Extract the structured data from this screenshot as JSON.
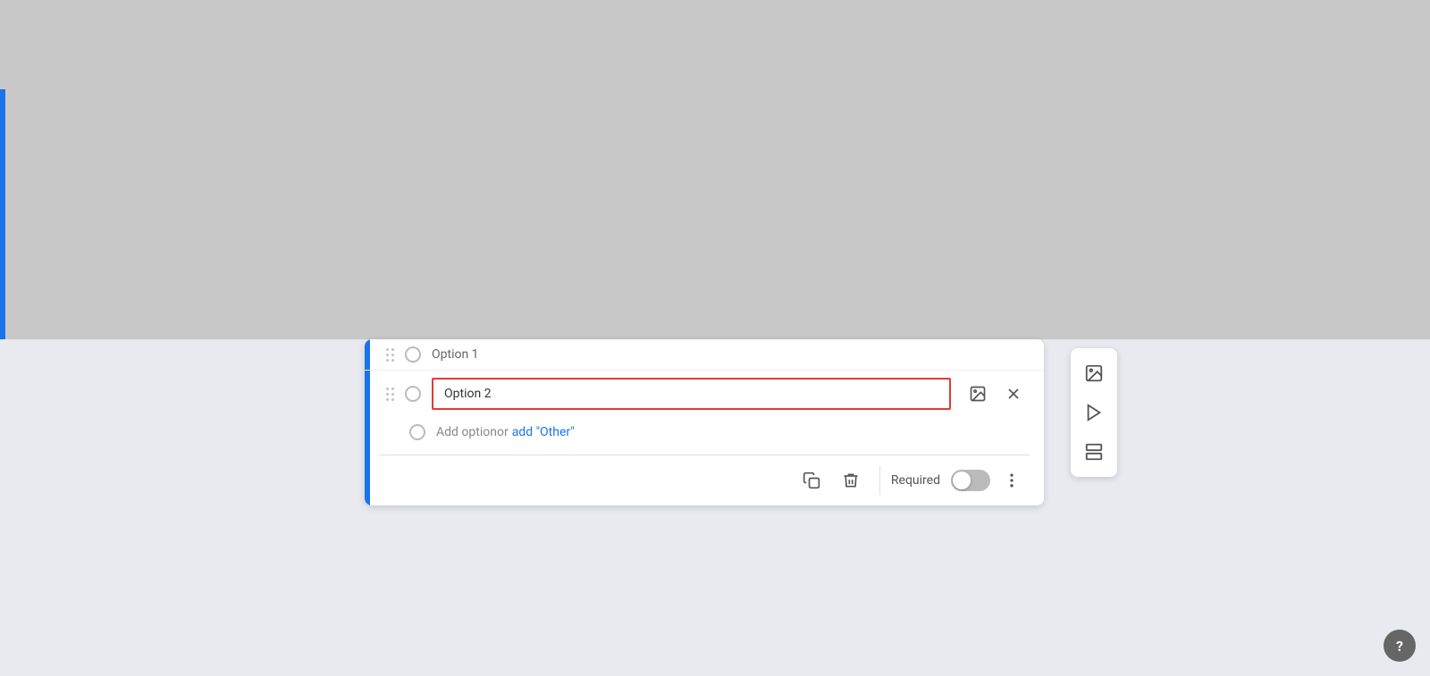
{
  "page": {
    "background_top": "#c8c8c8",
    "background_bottom": "#e8eaf0"
  },
  "card": {
    "option1_placeholder": "Option 1",
    "option2_value": "Option 2",
    "add_option_text": "Add option",
    "add_option_separator": " or ",
    "add_other_text": "add \"Other\"",
    "required_label": "Required",
    "accent_color": "#1a73e8"
  },
  "toolbar": {
    "copy_label": "Copy",
    "delete_label": "Delete",
    "more_label": "More options",
    "required_toggle_active": false
  },
  "sidebar": {
    "image_icon_label": "Add image",
    "video_icon_label": "Add video",
    "section_icon_label": "Add section"
  },
  "help": {
    "label": "?"
  }
}
